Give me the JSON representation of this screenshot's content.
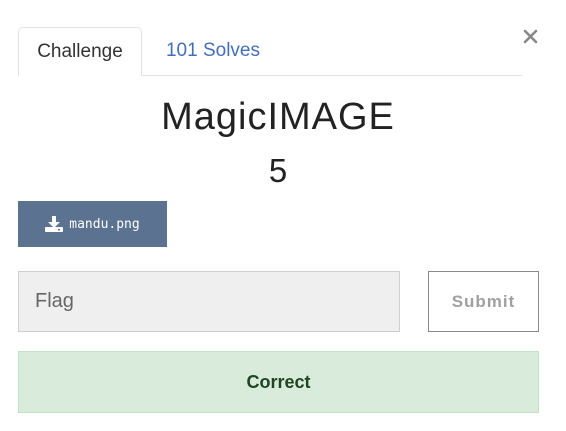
{
  "tabs": [
    {
      "label": "Challenge"
    },
    {
      "label": "101 Solves"
    }
  ],
  "close_icon": "close-icon",
  "challenge": {
    "name": "MagicIMAGE",
    "points": "5"
  },
  "download": {
    "icon": "download-icon",
    "filename": "mandu.png"
  },
  "flag_form": {
    "placeholder": "Flag",
    "value": "",
    "submit_label": "Submit"
  },
  "result": {
    "message": "Correct",
    "color": "#d9ecdb"
  }
}
